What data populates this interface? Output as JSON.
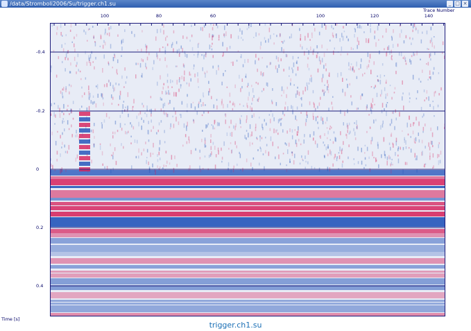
{
  "window": {
    "title": "/data/Stromboli2006/Su/trigger.ch1.su"
  },
  "plot": {
    "trace_label": "Trace Number",
    "x_ticks": [
      "100",
      "80",
      "60",
      "100",
      "120",
      "140"
    ],
    "y_ticks": [
      "-0.4",
      "-0.2",
      "0",
      "0.2",
      "0.4"
    ],
    "y_label": "Time [s]",
    "footer": "trigger.ch1.su",
    "colors": {
      "frame": "#1a1a7a",
      "positive": "#d61f5a",
      "negative": "#1d4fb8",
      "background": "#e8ecf6"
    }
  }
}
